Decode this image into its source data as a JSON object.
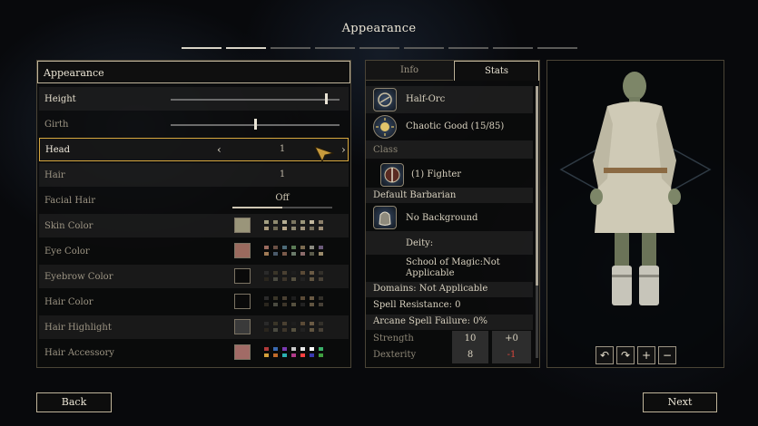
{
  "screen": {
    "title": "Appearance"
  },
  "appearance": {
    "header": "Appearance",
    "rows": {
      "height": {
        "label": "Height",
        "value": 0.93
      },
      "girth": {
        "label": "Girth",
        "value": 0.5
      },
      "head": {
        "label": "Head",
        "value": "1"
      },
      "hair": {
        "label": "Hair",
        "value": "1"
      },
      "facial_hair": {
        "label": "Facial Hair",
        "value": "Off"
      },
      "skin_color": {
        "label": "Skin Color",
        "color": "#9a957a"
      },
      "eye_color": {
        "label": "Eye Color",
        "color": "#9a6a5e"
      },
      "eyebrow_color": {
        "label": "Eyebrow Color",
        "color": "#0a0a0a"
      },
      "hair_color": {
        "label": "Hair Color",
        "color": "#0a0a0a"
      },
      "hair_highlight": {
        "label": "Hair Highlight",
        "color": "#3a3a3a"
      },
      "hair_accessory": {
        "label": "Hair Accessory",
        "color": "#a16b66"
      }
    }
  },
  "stats_panel": {
    "tabs": {
      "info": "Info",
      "stats": "Stats"
    },
    "race": "Half-Orc",
    "alignment": "Chaotic Good (15/85)",
    "class_heading": "Class",
    "class_entry": "(1) Fighter",
    "default_package": "Default Barbarian",
    "background": "No Background",
    "deity": "Deity:",
    "school_of_magic": "School of Magic:Not Applicable",
    "domains": "Domains: Not Applicable",
    "spell_resistance": "Spell Resistance: 0",
    "arcane_failure": "Arcane Spell Failure: 0%",
    "abilities": {
      "strength": {
        "label": "Strength",
        "score": "10",
        "mod": "+0"
      },
      "dexterity": {
        "label": "Dexterity",
        "score": "8",
        "mod": "-1"
      }
    }
  },
  "buttons": {
    "back": "Back",
    "next": "Next"
  },
  "icons": {
    "rotate_left": "↶",
    "rotate_right": "↷",
    "zoom_in": "+",
    "zoom_out": "−",
    "chevron_left": "‹",
    "chevron_right": "›"
  }
}
